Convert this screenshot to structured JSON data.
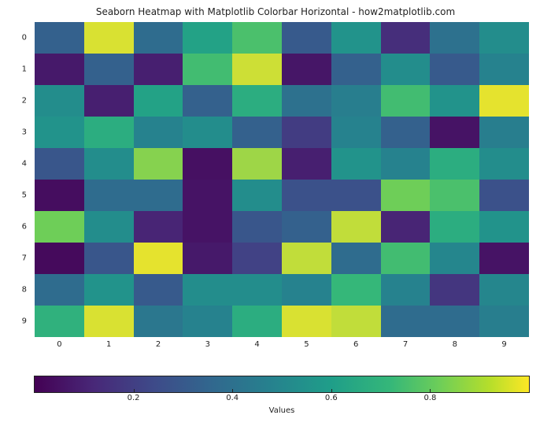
{
  "chart_data": {
    "type": "heatmap",
    "title": "Seaborn Heatmap with Matplotlib Colorbar Horizontal - how2matplotlib.com",
    "xlabel": "",
    "ylabel": "",
    "x_categories": [
      "0",
      "1",
      "2",
      "3",
      "4",
      "5",
      "6",
      "7",
      "8",
      "9"
    ],
    "y_categories": [
      "0",
      "1",
      "2",
      "3",
      "4",
      "5",
      "6",
      "7",
      "8",
      "9"
    ],
    "values": [
      [
        0.35,
        0.97,
        0.4,
        0.65,
        0.8,
        0.32,
        0.58,
        0.15,
        0.42,
        0.55
      ],
      [
        0.08,
        0.35,
        0.1,
        0.78,
        0.96,
        0.07,
        0.35,
        0.55,
        0.32,
        0.5
      ],
      [
        0.55,
        0.1,
        0.65,
        0.35,
        0.7,
        0.42,
        0.48,
        0.78,
        0.58,
        0.98
      ],
      [
        0.58,
        0.7,
        0.5,
        0.55,
        0.35,
        0.2,
        0.5,
        0.35,
        0.06,
        0.48
      ],
      [
        0.3,
        0.55,
        0.9,
        0.05,
        0.92,
        0.1,
        0.58,
        0.5,
        0.7,
        0.55
      ],
      [
        0.04,
        0.4,
        0.4,
        0.06,
        0.55,
        0.28,
        0.28,
        0.88,
        0.8,
        0.28
      ],
      [
        0.88,
        0.55,
        0.12,
        0.06,
        0.3,
        0.35,
        0.95,
        0.12,
        0.7,
        0.58
      ],
      [
        0.03,
        0.3,
        0.98,
        0.08,
        0.22,
        0.95,
        0.4,
        0.78,
        0.52,
        0.06
      ],
      [
        0.4,
        0.58,
        0.32,
        0.55,
        0.55,
        0.5,
        0.75,
        0.5,
        0.18,
        0.52
      ],
      [
        0.72,
        0.97,
        0.45,
        0.5,
        0.7,
        0.97,
        0.95,
        0.4,
        0.4,
        0.48
      ]
    ],
    "vmin": 0.0,
    "vmax": 1.0,
    "colormap": "viridis",
    "colorbar": {
      "orientation": "horizontal",
      "label": "Values",
      "ticks": [
        0.2,
        0.4,
        0.6,
        0.8
      ]
    }
  }
}
